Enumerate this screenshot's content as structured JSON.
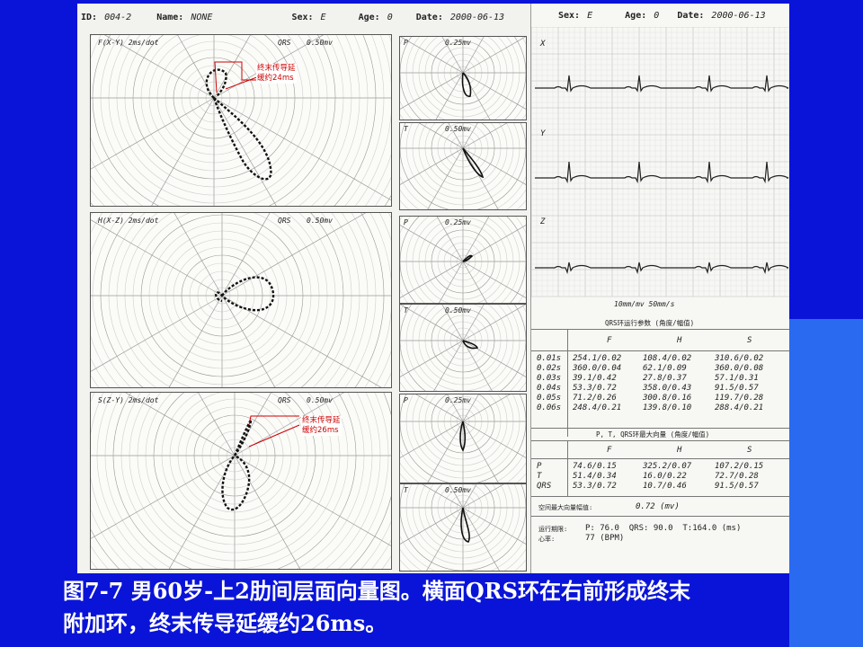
{
  "header": {
    "id_label": "ID:",
    "id_value": "004-2",
    "name_label": "Name:",
    "name_value": "NONE",
    "sex_label": "Sex:",
    "sex_value": "E",
    "age_label": "Age:",
    "age_value": "0",
    "date_label": "Date:",
    "date_value": "2000-06-13"
  },
  "right_header": {
    "sex_label": "Sex:",
    "sex_value": "E",
    "age_label": "Age:",
    "age_value": "0",
    "date_label": "Date:",
    "date_value": "2000-06-13"
  },
  "panels": {
    "frontal": {
      "title": "F(X-Y) 2ms/dot",
      "scale_label": "QRS",
      "scale_value": "0.50mv"
    },
    "horizontal": {
      "title": "H(X-Z) 2ms/dot",
      "scale_label": "QRS",
      "scale_value": "0.50mv"
    },
    "sagittal": {
      "title": "S(Z-Y) 2ms/dot",
      "scale_label": "QRS",
      "scale_value": "0.50mv"
    }
  },
  "small_panels": [
    {
      "label": "P",
      "value": "0.25mv"
    },
    {
      "label": "T",
      "value": "0.50mv"
    },
    {
      "label": "P",
      "value": "0.25mv"
    },
    {
      "label": "T",
      "value": "0.50mv"
    },
    {
      "label": "P",
      "value": "0.25mv"
    },
    {
      "label": "T",
      "value": "0.50mv"
    }
  ],
  "annotations": {
    "frontal_note": [
      "终末传导延",
      "缓约24ms"
    ],
    "sagittal_note": [
      "终末传导延",
      "缓约26ms"
    ]
  },
  "ecg": {
    "lead_x": "X",
    "lead_y": "Y",
    "lead_z": "Z",
    "speed": "10mm/mv  50mm/s"
  },
  "qrs_table": {
    "title": "QRS环运行参数 (角度/幅值)",
    "headers": [
      "F",
      "H",
      "S"
    ],
    "rows": [
      {
        "t": "0.01s",
        "f": "254.1/0.02",
        "h": "108.4/0.02",
        "s": "310.6/0.02"
      },
      {
        "t": "0.02s",
        "f": "360.0/0.04",
        "h": "62.1/0.09",
        "s": "360.0/0.08"
      },
      {
        "t": "0.03s",
        "f": "39.1/0.42",
        "h": "27.8/0.37",
        "s": "57.1/0.31"
      },
      {
        "t": "0.04s",
        "f": "53.3/0.72",
        "h": "358.0/0.43",
        "s": "91.5/0.57"
      },
      {
        "t": "0.05s",
        "f": "71.2/0.26",
        "h": "300.8/0.16",
        "s": "119.7/0.28"
      },
      {
        "t": "0.06s",
        "f": "248.4/0.21",
        "h": "139.8/0.10",
        "s": "288.4/0.21"
      }
    ]
  },
  "vector_table": {
    "title": "P, T, QRS环最大向量 (角度/幅值)",
    "headers": [
      "F",
      "H",
      "S"
    ],
    "rows": [
      {
        "t": "P",
        "f": "74.6/0.15",
        "h": "325.2/0.07",
        "s": "107.2/0.15"
      },
      {
        "t": "T",
        "f": "51.4/0.34",
        "h": "16.0/0.22",
        "s": "72.7/0.28"
      },
      {
        "t": "QRS",
        "f": "53.3/0.72",
        "h": "10.7/0.46",
        "s": "91.5/0.57"
      }
    ]
  },
  "summary": {
    "max_amp_label": "空间最大向量幅值:",
    "max_amp_value": "0.72 (mv)",
    "interval_label": "运行期限:",
    "interval_value": "P: 76.0  QRS: 90.0  T:164.0 (ms)",
    "hr_label": "心率:",
    "hr_value": "77 (BPM)"
  },
  "caption": {
    "line1": "图7-7  男60岁-上2肋间层面向量图。横面QRS环在右前形成终末",
    "line2": "附加环，终末传导延缓约26ms。"
  },
  "colors": {
    "background": "#0a14d8",
    "accent_block": "#2a6af0",
    "annotation": "#cc0000"
  }
}
